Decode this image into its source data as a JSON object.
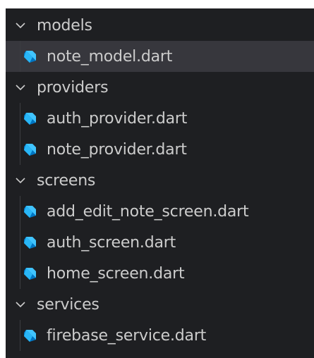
{
  "explorer": {
    "folders": [
      {
        "name": "models",
        "expanded": true,
        "files": [
          {
            "name": "note_model.dart",
            "selected": true
          }
        ]
      },
      {
        "name": "providers",
        "expanded": true,
        "files": [
          {
            "name": "auth_provider.dart",
            "selected": false
          },
          {
            "name": "note_provider.dart",
            "selected": false
          }
        ]
      },
      {
        "name": "screens",
        "expanded": true,
        "files": [
          {
            "name": "add_edit_note_screen.dart",
            "selected": false
          },
          {
            "name": "auth_screen.dart",
            "selected": false
          },
          {
            "name": "home_screen.dart",
            "selected": false
          }
        ]
      },
      {
        "name": "services",
        "expanded": true,
        "files": [
          {
            "name": "firebase_service.dart",
            "selected": false
          }
        ]
      }
    ],
    "icons": {
      "folder_chevron": "chevron-down-icon",
      "file": "dart-file-icon"
    },
    "colors": {
      "background": "#1e1f22",
      "selected_row": "#37373d",
      "text": "#cccccc",
      "dart_icon_light": "#40c4ff",
      "dart_icon_dark": "#0175c2"
    }
  }
}
